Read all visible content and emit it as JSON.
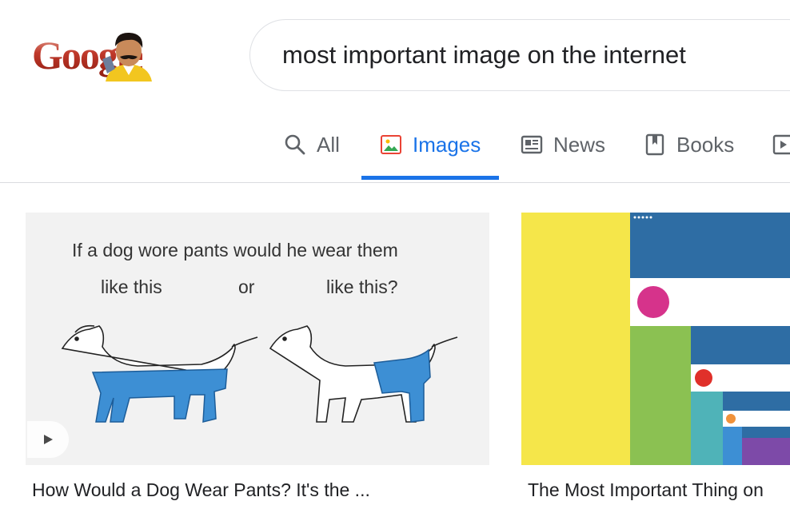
{
  "logo": {
    "text": "Google",
    "doodle": "doodle-portrait-icon"
  },
  "search": {
    "query": "most important image on the internet",
    "placeholder": ""
  },
  "tabs": [
    {
      "label": "All",
      "icon": "search-icon",
      "active": false
    },
    {
      "label": "Images",
      "icon": "image-icon",
      "active": true
    },
    {
      "label": "News",
      "icon": "news-icon",
      "active": false
    },
    {
      "label": "Books",
      "icon": "book-icon",
      "active": false
    },
    {
      "label": "",
      "icon": "video-icon",
      "active": false
    }
  ],
  "results": [
    {
      "title": "How Would a Dog Wear Pants? It's the ...",
      "meme": {
        "headline": "If a dog wore pants would he wear them",
        "left_label": "like this",
        "middle_label": "or",
        "right_label": "like this?"
      },
      "has_video": true
    },
    {
      "title": "The Most Important Thing on",
      "has_video": false
    }
  ],
  "colors": {
    "accent": "#1a73e8",
    "inactive_tab": "#5f6368",
    "divider": "#dadce0",
    "pants": "#3d8fd4",
    "spiral_yellow": "#f5e64a",
    "spiral_blue": "#2e6da4",
    "spiral_green": "#8bc152",
    "spiral_pink": "#d6338b",
    "spiral_red": "#e0302a",
    "spiral_teal": "#4fb3b8",
    "spiral_orange": "#f0923b"
  }
}
